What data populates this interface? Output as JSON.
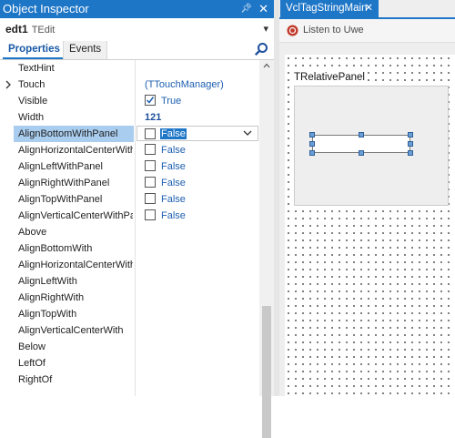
{
  "inspector": {
    "title": "Object Inspector",
    "component": {
      "name": "edt1",
      "type": "TEdit"
    },
    "tabs": [
      "Properties",
      "Events"
    ],
    "properties": [
      {
        "name": "TextHint"
      },
      {
        "name": "Touch",
        "value": "(TTouchManager)",
        "expandable": true
      },
      {
        "name": "Visible",
        "checkbox": true,
        "checked": true,
        "value": "True"
      },
      {
        "name": "Width",
        "value": "121",
        "bold": true
      },
      {
        "name": "AlignBottomWithPanel",
        "checkbox": true,
        "checked": false,
        "value": "False",
        "selected": true
      },
      {
        "name": "AlignHorizontalCenterWithPanel",
        "checkbox": true,
        "checked": false,
        "value": "False"
      },
      {
        "name": "AlignLeftWithPanel",
        "checkbox": true,
        "checked": false,
        "value": "False"
      },
      {
        "name": "AlignRightWithPanel",
        "checkbox": true,
        "checked": false,
        "value": "False"
      },
      {
        "name": "AlignTopWithPanel",
        "checkbox": true,
        "checked": false,
        "value": "False"
      },
      {
        "name": "AlignVerticalCenterWithPanel",
        "checkbox": true,
        "checked": false,
        "value": "False"
      },
      {
        "name": "Above"
      },
      {
        "name": "AlignBottomWith"
      },
      {
        "name": "AlignHorizontalCenterWith"
      },
      {
        "name": "AlignLeftWith"
      },
      {
        "name": "AlignRightWith"
      },
      {
        "name": "AlignTopWith"
      },
      {
        "name": "AlignVerticalCenterWith"
      },
      {
        "name": "Below"
      },
      {
        "name": "LeftOf"
      },
      {
        "name": "RightOf"
      }
    ]
  },
  "designer": {
    "tab": "VclTagStringMain",
    "listen_label": "Listen to Uwe",
    "panel_label": "TRelativePanel"
  },
  "colors": {
    "accent": "#1e76c7",
    "selection": "#a9cdee",
    "value_text": "#1e5fb0"
  }
}
